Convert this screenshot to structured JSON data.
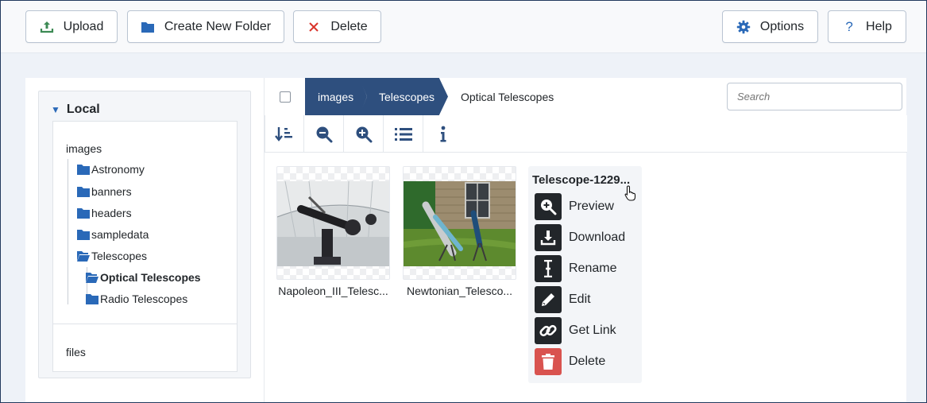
{
  "toolbar": {
    "upload": "Upload",
    "create_folder": "Create New Folder",
    "delete": "Delete",
    "options": "Options",
    "help": "Help"
  },
  "sidebar": {
    "title": "Local",
    "root": "images",
    "folders": [
      {
        "label": "Astronomy"
      },
      {
        "label": "banners"
      },
      {
        "label": "headers"
      },
      {
        "label": "sampledata"
      },
      {
        "label": "Telescopes"
      },
      {
        "label": "Optical Telescopes"
      },
      {
        "label": "Radio Telescopes"
      }
    ],
    "files_label": "files"
  },
  "breadcrumb": [
    "images",
    "Telescopes",
    "Optical Telescopes"
  ],
  "search": {
    "placeholder": "Search"
  },
  "items": [
    {
      "name": "Napoleon_III_Telesc..."
    },
    {
      "name": "Newtonian_Telesco..."
    }
  ],
  "context_menu": {
    "title": "Telescope-1229...",
    "actions": [
      "Preview",
      "Download",
      "Rename",
      "Edit",
      "Get Link",
      "Delete"
    ]
  },
  "colors": {
    "accent": "#2e4f7e",
    "folder": "#2a69b8",
    "danger": "#d9534f"
  }
}
